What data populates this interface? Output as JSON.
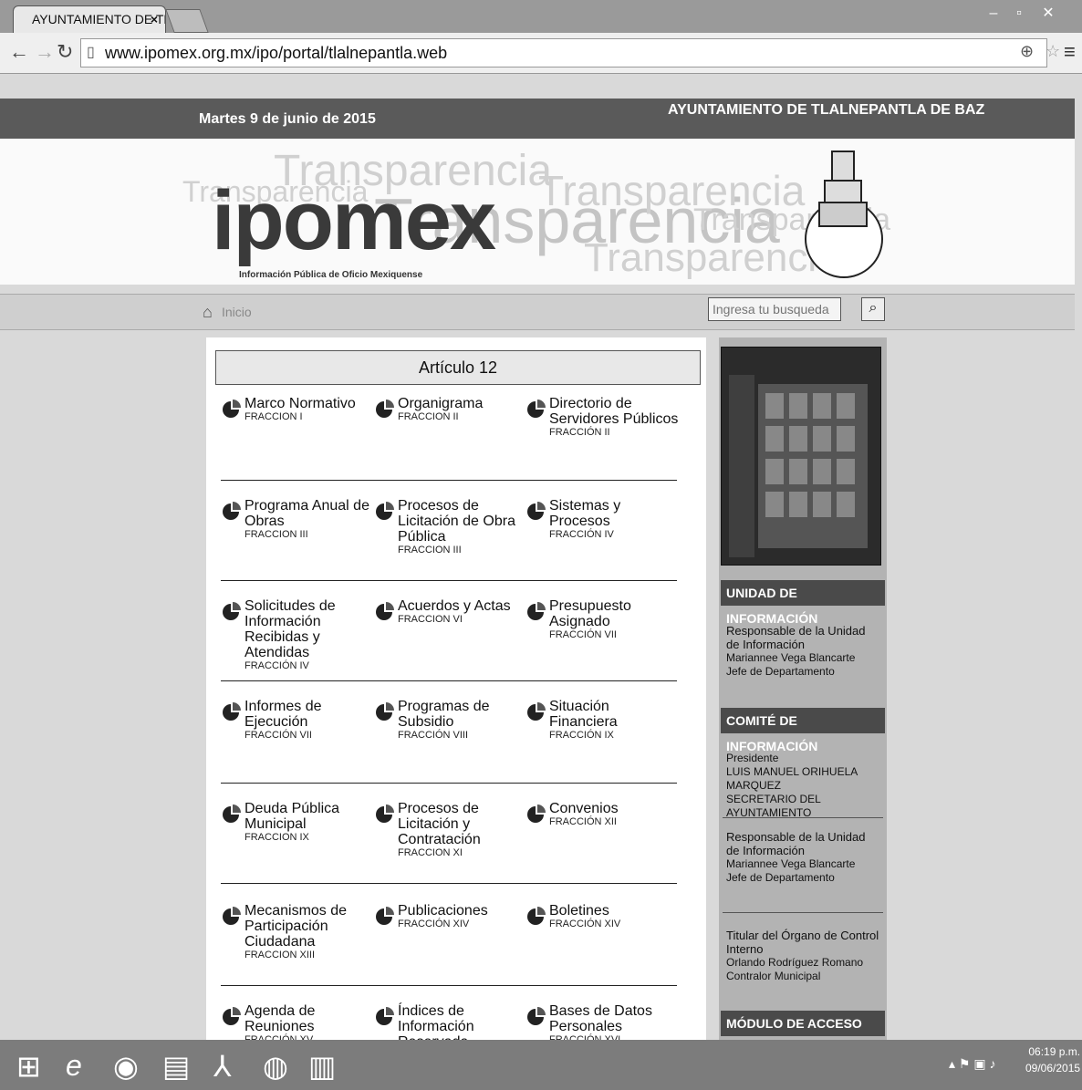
{
  "browser": {
    "tab_title": "AYUNTAMIENTO DE TLAL",
    "tab_close": "×",
    "url": "www.ipomex.org.mx/ipo/portal/tlalnepantla.web"
  },
  "header": {
    "date": "Martes 9 de junio de 2015",
    "municipality": "AYUNTAMIENTO DE TLALNEPANTLA DE BAZ",
    "logo": "ipomex",
    "tagline": "Información Pública de Oficio Mexiquense",
    "watermark_word": "Transparencia"
  },
  "nav": {
    "home_label": "Inicio",
    "search_placeholder": "Ingresa tu busqueda"
  },
  "main": {
    "section_title": "Artículo 12",
    "items": [
      {
        "name": "Marco Normativo",
        "fraction": "FRACCION I"
      },
      {
        "name": "Organigrama",
        "fraction": "FRACCION II"
      },
      {
        "name": "Directorio de Servidores Públicos",
        "fraction": "FRACCIÓN II"
      },
      {
        "name": "Programa Anual de Obras",
        "fraction": "FRACCION III"
      },
      {
        "name": "Procesos de Licitación de Obra Pública",
        "fraction": "FRACCION III"
      },
      {
        "name": "Sistemas y Procesos",
        "fraction": "FRACCIÓN IV"
      },
      {
        "name": "Solicitudes de Información Recibidas y Atendidas",
        "fraction": "FRACCIÓN IV"
      },
      {
        "name": "Acuerdos y Actas",
        "fraction": "FRACCION VI"
      },
      {
        "name": "Presupuesto Asignado",
        "fraction": "FRACCIÓN VII"
      },
      {
        "name": "Informes de Ejecución",
        "fraction": "FRACCIÓN VII"
      },
      {
        "name": "Programas de Subsidio",
        "fraction": "FRACCIÓN VIII"
      },
      {
        "name": "Situación Financiera",
        "fraction": "FRACCIÓN IX"
      },
      {
        "name": "Deuda Pública Municipal",
        "fraction": "FRACCION IX"
      },
      {
        "name": "Procesos de Licitación y Contratación",
        "fraction": "FRACCION XI"
      },
      {
        "name": "Convenios",
        "fraction": "FRACCIÓN XII"
      },
      {
        "name": "Mecanismos de Participación Ciudadana",
        "fraction": "FRACCION XIII"
      },
      {
        "name": "Publicaciones",
        "fraction": "FRACCIÓN XIV"
      },
      {
        "name": "Boletines",
        "fraction": "FRACCIÓN XIV"
      },
      {
        "name": "Agenda de Reuniones",
        "fraction": "FRACCIÓN XV"
      },
      {
        "name": "Índices de Información Reservada",
        "fraction": ""
      },
      {
        "name": "Bases de Datos Personales",
        "fraction": "FRACCIÓN XVI"
      }
    ]
  },
  "sidebar": {
    "unidad_title": "UNIDAD DE INFORMACIÓN",
    "unidad_role": "Responsable de la Unidad de Información",
    "unidad_name": "Mariannee Vega Blancarte",
    "unidad_position": "Jefe de Departamento",
    "comite_title": "COMITÉ DE INFORMACIÓN",
    "pres_role": "Presidente",
    "pres_name": "LUIS MANUEL ORIHUELA MARQUEZ",
    "pres_position": "SECRETARIO DEL AYUNTAMIENTO",
    "resp_role": "Responsable de la Unidad de Información",
    "resp_name": "Mariannee Vega Blancarte",
    "resp_position": "Jefe de Departamento",
    "titular_role": "Titular del Órgano de Control Interno",
    "titular_name": "Orlando Rodríguez Romano",
    "titular_position": "Contralor Municipal",
    "acceso_title": "MÓDULO DE ACCESO"
  },
  "taskbar": {
    "time": "06:19 p.m.",
    "date": "09/06/2015"
  }
}
